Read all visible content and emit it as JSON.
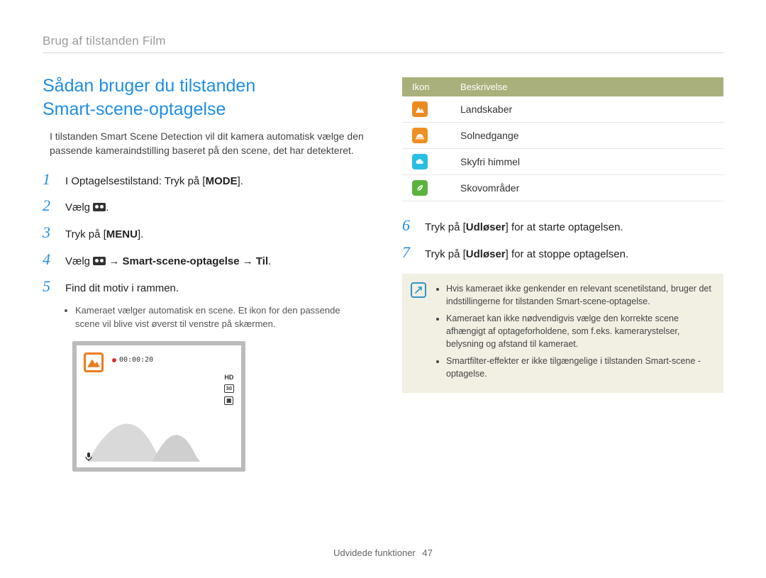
{
  "breadcrumb": "Brug af tilstanden Film",
  "title_line1": "Sådan bruger du tilstanden",
  "title_line2": "Smart-scene-optagelse",
  "intro": "I tilstanden Smart Scene Detection vil dit kamera automatisk vælge den passende kameraindstilling baseret på den scene, det har detekteret.",
  "steps_left": [
    {
      "num": "1",
      "pre": "I Optagelsestilstand: Tryk på [",
      "kbd": "MODE",
      "post": "]."
    },
    {
      "num": "2",
      "pre": "Vælg ",
      "icon": "film",
      "post": "."
    },
    {
      "num": "3",
      "pre": "Tryk på [",
      "kbd": "MENU",
      "post": "]."
    },
    {
      "num": "4",
      "pre": "Vælg ",
      "icon": "film",
      "bold": " → Smart-scene-optagelse → Til",
      "post": "."
    },
    {
      "num": "5",
      "pre": "Find dit motiv i rammen.",
      "post": ""
    }
  ],
  "subnote": "Kameraet vælger automatisk en scene. Et ikon for den passende scene vil blive vist øverst til venstre på skærmen.",
  "cam": {
    "time": "00:00:20",
    "hd": "HD",
    "sd": "30",
    "bat": "▦"
  },
  "iconTable": {
    "headers": {
      "icon": "Ikon",
      "desc": "Beskrivelse"
    },
    "rows": [
      {
        "desc": "Landskaber",
        "tile": "orange",
        "glyph": "landscape"
      },
      {
        "desc": "Solnedgange",
        "tile": "orange2",
        "glyph": "sunset"
      },
      {
        "desc": "Skyfri himmel",
        "tile": "cyan",
        "glyph": "cloud"
      },
      {
        "desc": "Skovområder",
        "tile": "green",
        "glyph": "leaf"
      }
    ]
  },
  "steps_right": [
    {
      "num": "6",
      "pre": "Tryk på [",
      "kbd": "Udløser",
      "post": "] for at starte optagelsen."
    },
    {
      "num": "7",
      "pre": "Tryk på [",
      "kbd": "Udløser",
      "post": "] for at stoppe optagelsen."
    }
  ],
  "notes": [
    "Hvis kameraet ikke genkender en relevant scenetilstand, bruger det indstillingerne for tilstanden Smart-scene-optagelse.",
    "Kameraet kan ikke nødvendigvis vælge den korrekte scene afhængigt af optageforholdene, som f.eks. kamerarystelser, belysning og afstand til kameraet.",
    "Smartfilter-effekter er ikke tilgængelige i tilstanden Smart-scene -optagelse."
  ],
  "footer": {
    "section": "Udvidede funktioner",
    "page": "47"
  }
}
